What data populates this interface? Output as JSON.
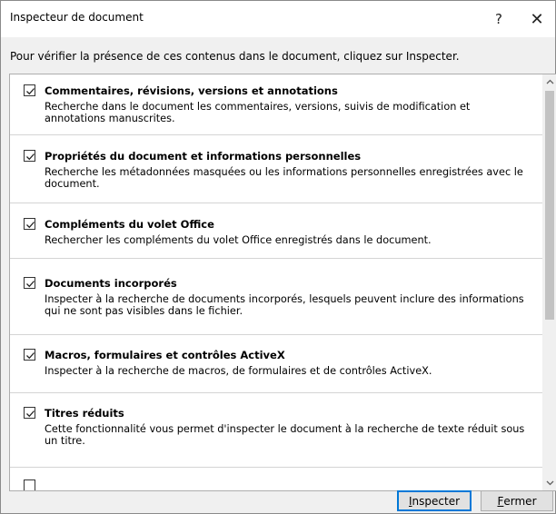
{
  "window": {
    "title": "Inspecteur de document",
    "help_label": "?",
    "close_label": "✕"
  },
  "instructions": "Pour vérifier la présence de ces contenus dans le document, cliquez sur Inspecter.",
  "items": [
    {
      "checked": true,
      "title": "Commentaires, révisions, versions et annotations",
      "desc": "Recherche dans le document les commentaires, versions, suivis de modification et annotations manuscrites."
    },
    {
      "checked": true,
      "title": "Propriétés du document et informations personnelles",
      "desc": "Recherche les métadonnées masquées ou les informations personnelles enregistrées avec le document."
    },
    {
      "checked": true,
      "title": "Compléments du volet Office",
      "desc": "Rechercher les compléments du volet Office enregistrés dans le document."
    },
    {
      "checked": true,
      "title": "Documents incorporés",
      "desc": "Inspecter à la recherche de documents incorporés, lesquels peuvent inclure des informations qui ne sont pas visibles dans le fichier."
    },
    {
      "checked": true,
      "title": "Macros, formulaires et contrôles ActiveX",
      "desc": "Inspecter à la recherche de macros, de formulaires et de contrôles ActiveX."
    },
    {
      "checked": true,
      "title": "Titres réduits",
      "desc": "Cette fonctionnalité vous permet d'inspecter le document à la recherche de texte réduit sous un titre."
    }
  ],
  "buttons": {
    "inspect_mnemonic": "I",
    "inspect_rest": "nspecter",
    "close_mnemonic": "F",
    "close_rest": "ermer"
  }
}
